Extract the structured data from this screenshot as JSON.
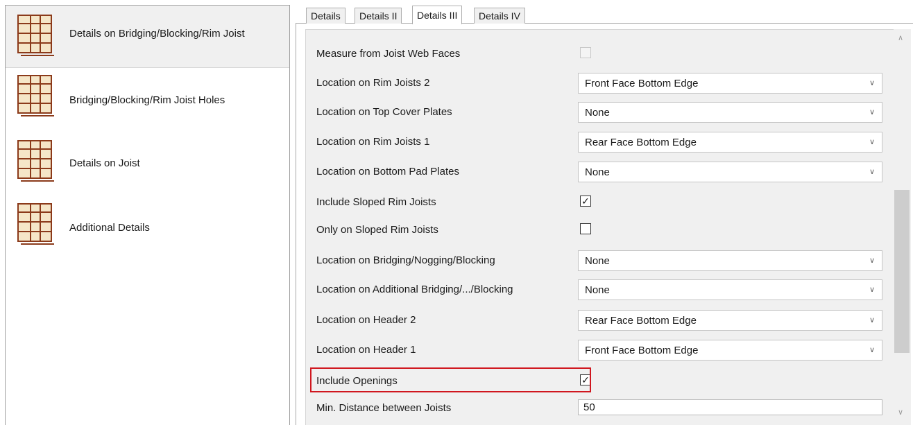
{
  "sidebar": {
    "items": [
      {
        "label": "Details on Bridging/Blocking/Rim Joist",
        "icon": "frame-grid-icon",
        "selected": true
      },
      {
        "label": "Bridging/Blocking/Rim Joist Holes",
        "icon": "frame-grid-icon",
        "selected": false
      },
      {
        "label": "Details on Joist",
        "icon": "frame-grid-icon",
        "selected": false
      },
      {
        "label": "Additional Details",
        "icon": "frame-grid-icon",
        "selected": false
      }
    ]
  },
  "tabs": [
    {
      "label": "Details",
      "active": false
    },
    {
      "label": "Details II",
      "active": false
    },
    {
      "label": "Details III",
      "active": true
    },
    {
      "label": "Details IV",
      "active": false
    }
  ],
  "form": {
    "rows": [
      {
        "label": "Measure from Joist Web Faces",
        "type": "checkbox",
        "checked": false,
        "disabled": true
      },
      {
        "label": "Location on Rim Joists 2",
        "type": "select",
        "value": "Front Face Bottom Edge"
      },
      {
        "label": "Location on Top Cover Plates",
        "type": "select",
        "value": "None"
      },
      {
        "label": "Location on Rim Joists 1",
        "type": "select",
        "value": "Rear Face Bottom Edge"
      },
      {
        "label": "Location on Bottom Pad Plates",
        "type": "select",
        "value": "None"
      },
      {
        "label": "Include Sloped Rim Joists",
        "type": "checkbox",
        "checked": true
      },
      {
        "label": "Only on Sloped Rim Joists",
        "type": "checkbox",
        "checked": false
      },
      {
        "label": "Location on Bridging/Nogging/Blocking",
        "type": "select",
        "value": "None"
      },
      {
        "label": "Location on Additional Bridging/.../Blocking",
        "type": "select",
        "value": "None"
      },
      {
        "label": "Location on Header 2",
        "type": "select",
        "value": "Rear Face Bottom Edge"
      },
      {
        "label": "Location on Header 1",
        "type": "select",
        "value": "Front Face Bottom Edge"
      },
      {
        "label": "Include Openings",
        "type": "checkbox",
        "checked": true,
        "highlighted": true
      },
      {
        "label": "Min. Distance between Joists",
        "type": "text",
        "value": "50"
      }
    ]
  },
  "colors": {
    "highlight": "#d0171f",
    "icon_fill": "#f5e6c8",
    "icon_stroke": "#8b3a1a",
    "panel_bg": "#f0f0f0"
  }
}
